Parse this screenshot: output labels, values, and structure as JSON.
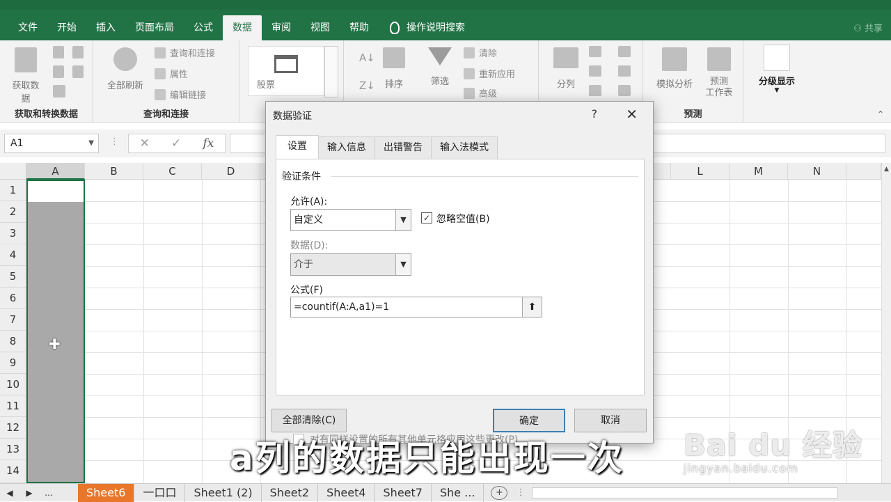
{
  "menu": {
    "tabs": [
      "文件",
      "开始",
      "插入",
      "页面布局",
      "公式",
      "数据",
      "审阅",
      "视图",
      "帮助"
    ],
    "active_tab": "数据",
    "search_label": "操作说明搜索",
    "share_label": "共享"
  },
  "ribbon": {
    "get_data": {
      "btn_label": "获取数据",
      "group_label": "获取和转换数据"
    },
    "queries": {
      "refresh_all": "全部刷新",
      "items": [
        "查询和连接",
        "属性",
        "编辑链接"
      ],
      "group_label": "查询和连接"
    },
    "stocks": {
      "label": "股票"
    },
    "sort_filter": {
      "sort": "排序",
      "filter": "筛选",
      "clear": "清除",
      "reapply": "重新应用",
      "advanced": "高级"
    },
    "data_tools": {
      "text_to_columns": "分列"
    },
    "forecast": {
      "what_if": "模拟分析",
      "forecast_sheet": "预测\n工作表",
      "group_label": "预测"
    },
    "outline": {
      "label": "分级显示"
    }
  },
  "formula_bar": {
    "name_box": "A1",
    "cancel": "✕",
    "enter": "✓",
    "fx": "fx"
  },
  "grid": {
    "left_columns": [
      "A",
      "B",
      "C",
      "D"
    ],
    "right_columns": [
      "L",
      "M",
      "N"
    ],
    "rows": [
      "1",
      "2",
      "3",
      "4",
      "5",
      "6",
      "7",
      "8",
      "9",
      "10",
      "11",
      "12",
      "13",
      "14"
    ]
  },
  "sheets": {
    "tabs": [
      "Sheet6",
      "一口口",
      "Sheet1 (2)",
      "Sheet2",
      "Sheet4",
      "Sheet7",
      "She ..."
    ],
    "active": "Sheet6",
    "more": "..."
  },
  "dialog": {
    "title": "数据验证",
    "help": "?",
    "close": "✕",
    "tabs": [
      "设置",
      "输入信息",
      "出错警告",
      "输入法模式"
    ],
    "active_tab": "设置",
    "section": "验证条件",
    "allow_label": "允许(A):",
    "allow_value": "自定义",
    "ignore_blank_label": "忽略空值(B)",
    "ignore_blank_checked": true,
    "data_label": "数据(D):",
    "data_value": "介于",
    "formula_label": "公式(F)",
    "formula_value": "=countif(A:A,a1)=1",
    "apply_all_label": "对有同样设置的所有其他单元格应用这些更改(P)",
    "apply_all_checked": false,
    "clear_all": "全部清除(C)",
    "ok": "确定",
    "cancel": "取消"
  },
  "subtitle": "a列的数据只能出现一次",
  "watermark": {
    "main": "Bai du 经验",
    "sub": "jingyan.baidu.com"
  },
  "colors": {
    "excel_green": "#217346",
    "sheet_active": "#e8772c"
  }
}
